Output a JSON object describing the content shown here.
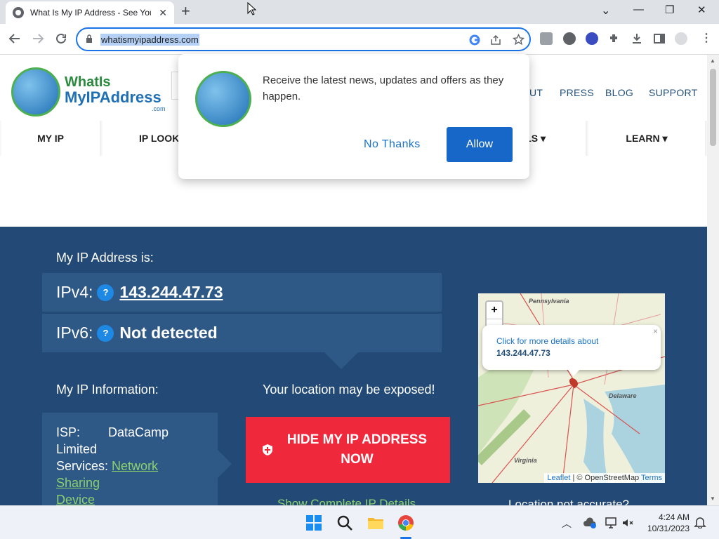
{
  "browser": {
    "tab_title": "What Is My IP Address - See You",
    "tab_close": "✕",
    "new_tab": "+",
    "url": "whatismyipaddress.com",
    "win_min": "—",
    "win_max": "❐",
    "win_close": "✕",
    "tab_search": "⌄"
  },
  "site": {
    "logo": {
      "line1": "WhatIs",
      "line2": "MyIPAddress",
      "line3": ".com"
    },
    "top_nav": [
      "UT",
      "PRESS",
      "BLOG",
      "SUPPORT"
    ],
    "main_nav": [
      "MY IP",
      "IP LOOK",
      "LS ▾",
      "LEARN ▾"
    ],
    "ip_label": "My IP Address is:",
    "ipv4_label": "IPv4:",
    "ipv4_value": "143.244.47.73",
    "ipv6_label": "IPv6:",
    "ipv6_value": "Not detected",
    "help_glyph": "?",
    "info_label": "My IP Information:",
    "exposed_label": "Your location may be exposed!",
    "isp_key": "ISP:",
    "isp_value": "DataCamp",
    "isp_value2": "Limited",
    "services_key": "Services:",
    "services_value1": "Network Sharing",
    "services_value2": "Device",
    "hide_button": "HIDE MY IP ADDRESS NOW",
    "show_details": "Show Complete IP Details",
    "location_question": "Location not accurate?",
    "map": {
      "zoom_in": "+",
      "zoom_out": "−",
      "popup_line1": "Click for more details about",
      "popup_line2": "143.244.47.73",
      "popup_close": "×",
      "places": [
        "Pennsylvania",
        "Delaware",
        "Virginia"
      ],
      "attr_leaflet": "Leaflet",
      "attr_sep": " | © OpenStreetMap ",
      "attr_terms": "Terms"
    }
  },
  "notification": {
    "message": "Receive the latest news, updates and offers as they happen.",
    "no_thanks": "No Thanks",
    "allow": "Allow"
  },
  "taskbar": {
    "time": "4:24 AM",
    "date": "10/31/2023"
  }
}
